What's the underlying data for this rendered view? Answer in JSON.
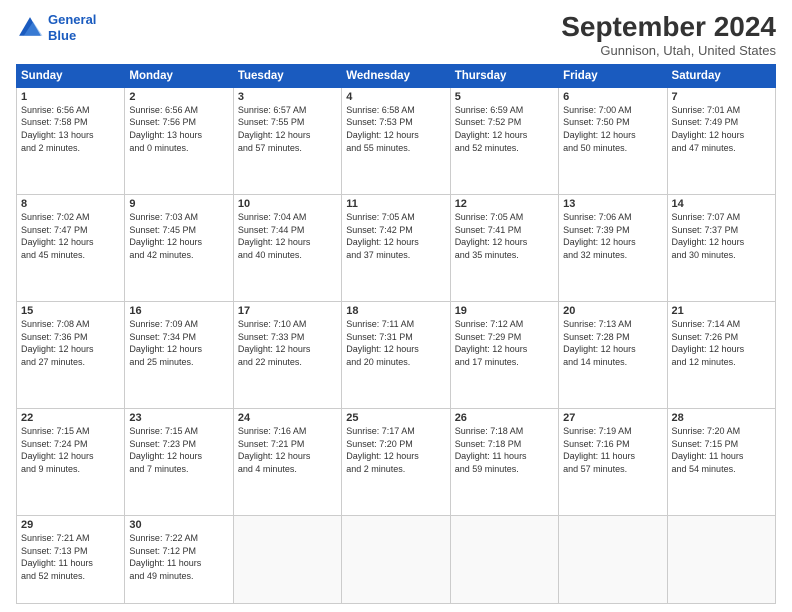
{
  "logo": {
    "line1": "General",
    "line2": "Blue"
  },
  "title": "September 2024",
  "location": "Gunnison, Utah, United States",
  "headers": [
    "Sunday",
    "Monday",
    "Tuesday",
    "Wednesday",
    "Thursday",
    "Friday",
    "Saturday"
  ],
  "weeks": [
    [
      {
        "day": "1",
        "info": "Sunrise: 6:56 AM\nSunset: 7:58 PM\nDaylight: 13 hours\nand 2 minutes."
      },
      {
        "day": "2",
        "info": "Sunrise: 6:56 AM\nSunset: 7:56 PM\nDaylight: 13 hours\nand 0 minutes."
      },
      {
        "day": "3",
        "info": "Sunrise: 6:57 AM\nSunset: 7:55 PM\nDaylight: 12 hours\nand 57 minutes."
      },
      {
        "day": "4",
        "info": "Sunrise: 6:58 AM\nSunset: 7:53 PM\nDaylight: 12 hours\nand 55 minutes."
      },
      {
        "day": "5",
        "info": "Sunrise: 6:59 AM\nSunset: 7:52 PM\nDaylight: 12 hours\nand 52 minutes."
      },
      {
        "day": "6",
        "info": "Sunrise: 7:00 AM\nSunset: 7:50 PM\nDaylight: 12 hours\nand 50 minutes."
      },
      {
        "day": "7",
        "info": "Sunrise: 7:01 AM\nSunset: 7:49 PM\nDaylight: 12 hours\nand 47 minutes."
      }
    ],
    [
      {
        "day": "8",
        "info": "Sunrise: 7:02 AM\nSunset: 7:47 PM\nDaylight: 12 hours\nand 45 minutes."
      },
      {
        "day": "9",
        "info": "Sunrise: 7:03 AM\nSunset: 7:45 PM\nDaylight: 12 hours\nand 42 minutes."
      },
      {
        "day": "10",
        "info": "Sunrise: 7:04 AM\nSunset: 7:44 PM\nDaylight: 12 hours\nand 40 minutes."
      },
      {
        "day": "11",
        "info": "Sunrise: 7:05 AM\nSunset: 7:42 PM\nDaylight: 12 hours\nand 37 minutes."
      },
      {
        "day": "12",
        "info": "Sunrise: 7:05 AM\nSunset: 7:41 PM\nDaylight: 12 hours\nand 35 minutes."
      },
      {
        "day": "13",
        "info": "Sunrise: 7:06 AM\nSunset: 7:39 PM\nDaylight: 12 hours\nand 32 minutes."
      },
      {
        "day": "14",
        "info": "Sunrise: 7:07 AM\nSunset: 7:37 PM\nDaylight: 12 hours\nand 30 minutes."
      }
    ],
    [
      {
        "day": "15",
        "info": "Sunrise: 7:08 AM\nSunset: 7:36 PM\nDaylight: 12 hours\nand 27 minutes."
      },
      {
        "day": "16",
        "info": "Sunrise: 7:09 AM\nSunset: 7:34 PM\nDaylight: 12 hours\nand 25 minutes."
      },
      {
        "day": "17",
        "info": "Sunrise: 7:10 AM\nSunset: 7:33 PM\nDaylight: 12 hours\nand 22 minutes."
      },
      {
        "day": "18",
        "info": "Sunrise: 7:11 AM\nSunset: 7:31 PM\nDaylight: 12 hours\nand 20 minutes."
      },
      {
        "day": "19",
        "info": "Sunrise: 7:12 AM\nSunset: 7:29 PM\nDaylight: 12 hours\nand 17 minutes."
      },
      {
        "day": "20",
        "info": "Sunrise: 7:13 AM\nSunset: 7:28 PM\nDaylight: 12 hours\nand 14 minutes."
      },
      {
        "day": "21",
        "info": "Sunrise: 7:14 AM\nSunset: 7:26 PM\nDaylight: 12 hours\nand 12 minutes."
      }
    ],
    [
      {
        "day": "22",
        "info": "Sunrise: 7:15 AM\nSunset: 7:24 PM\nDaylight: 12 hours\nand 9 minutes."
      },
      {
        "day": "23",
        "info": "Sunrise: 7:15 AM\nSunset: 7:23 PM\nDaylight: 12 hours\nand 7 minutes."
      },
      {
        "day": "24",
        "info": "Sunrise: 7:16 AM\nSunset: 7:21 PM\nDaylight: 12 hours\nand 4 minutes."
      },
      {
        "day": "25",
        "info": "Sunrise: 7:17 AM\nSunset: 7:20 PM\nDaylight: 12 hours\nand 2 minutes."
      },
      {
        "day": "26",
        "info": "Sunrise: 7:18 AM\nSunset: 7:18 PM\nDaylight: 11 hours\nand 59 minutes."
      },
      {
        "day": "27",
        "info": "Sunrise: 7:19 AM\nSunset: 7:16 PM\nDaylight: 11 hours\nand 57 minutes."
      },
      {
        "day": "28",
        "info": "Sunrise: 7:20 AM\nSunset: 7:15 PM\nDaylight: 11 hours\nand 54 minutes."
      }
    ],
    [
      {
        "day": "29",
        "info": "Sunrise: 7:21 AM\nSunset: 7:13 PM\nDaylight: 11 hours\nand 52 minutes."
      },
      {
        "day": "30",
        "info": "Sunrise: 7:22 AM\nSunset: 7:12 PM\nDaylight: 11 hours\nand 49 minutes."
      },
      {
        "day": "",
        "info": ""
      },
      {
        "day": "",
        "info": ""
      },
      {
        "day": "",
        "info": ""
      },
      {
        "day": "",
        "info": ""
      },
      {
        "day": "",
        "info": ""
      }
    ]
  ]
}
